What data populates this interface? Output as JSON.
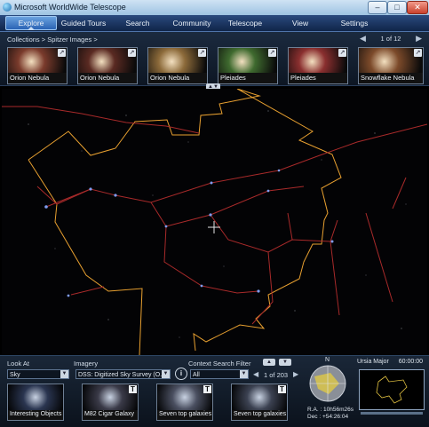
{
  "window": {
    "title": "Microsoft WorldWide Telescope",
    "minimize": "–",
    "maximize": "□",
    "close": "✕"
  },
  "menu": [
    {
      "label": "Explore"
    },
    {
      "label": "Guided Tours"
    },
    {
      "label": "Search"
    },
    {
      "label": "Community"
    },
    {
      "label": "Telescope"
    },
    {
      "label": "View"
    },
    {
      "label": "Settings"
    }
  ],
  "breadcrumb": "Collections  >  Spitzer Images  >",
  "pager": {
    "prev": "◀",
    "count": "1 of 12",
    "next": "▶"
  },
  "collection_thumbs": [
    {
      "caption": "Orion Nebula",
      "color": "#7a3b2c"
    },
    {
      "caption": "Orion Nebula",
      "color": "#5a2a22"
    },
    {
      "caption": "Orion Nebula",
      "color": "#8c6a3a"
    },
    {
      "caption": "Pleiades",
      "color": "#3f6a2f"
    },
    {
      "caption": "Pleiades",
      "color": "#8a2f2f"
    },
    {
      "caption": "Snowflake Nebula",
      "color": "#7c4a2a"
    }
  ],
  "collapse_glyph": "▲▼",
  "bottom": {
    "look_at_label": "Look At",
    "look_at_value": "Sky",
    "imagery_label": "Imagery",
    "imagery_value": "DSS: Digitized Sky Survey (O...",
    "context_label": "Context Search Filter",
    "context_value": "All",
    "result_pager": "1 of 203",
    "prev": "◀",
    "next": "▶",
    "info": "i",
    "caret": "▼",
    "up": "▲",
    "down": "▼"
  },
  "result_thumbs": [
    {
      "caption": "Interesting Objects",
      "color": "#2a3550"
    },
    {
      "caption": "M82 Cigar Galaxy",
      "color": "#3a3a48"
    },
    {
      "caption": "Seven top galaxies",
      "color": "#4a4f60"
    },
    {
      "caption": "Seven top galaxies",
      "color": "#3c4252"
    }
  ],
  "compass": {
    "north": "N",
    "ra": "R.A. : 10h56m26s",
    "dec": "Dec : +54:26:04"
  },
  "minimap": {
    "constellation": "Ursia Major",
    "fov": "60:00:00"
  }
}
